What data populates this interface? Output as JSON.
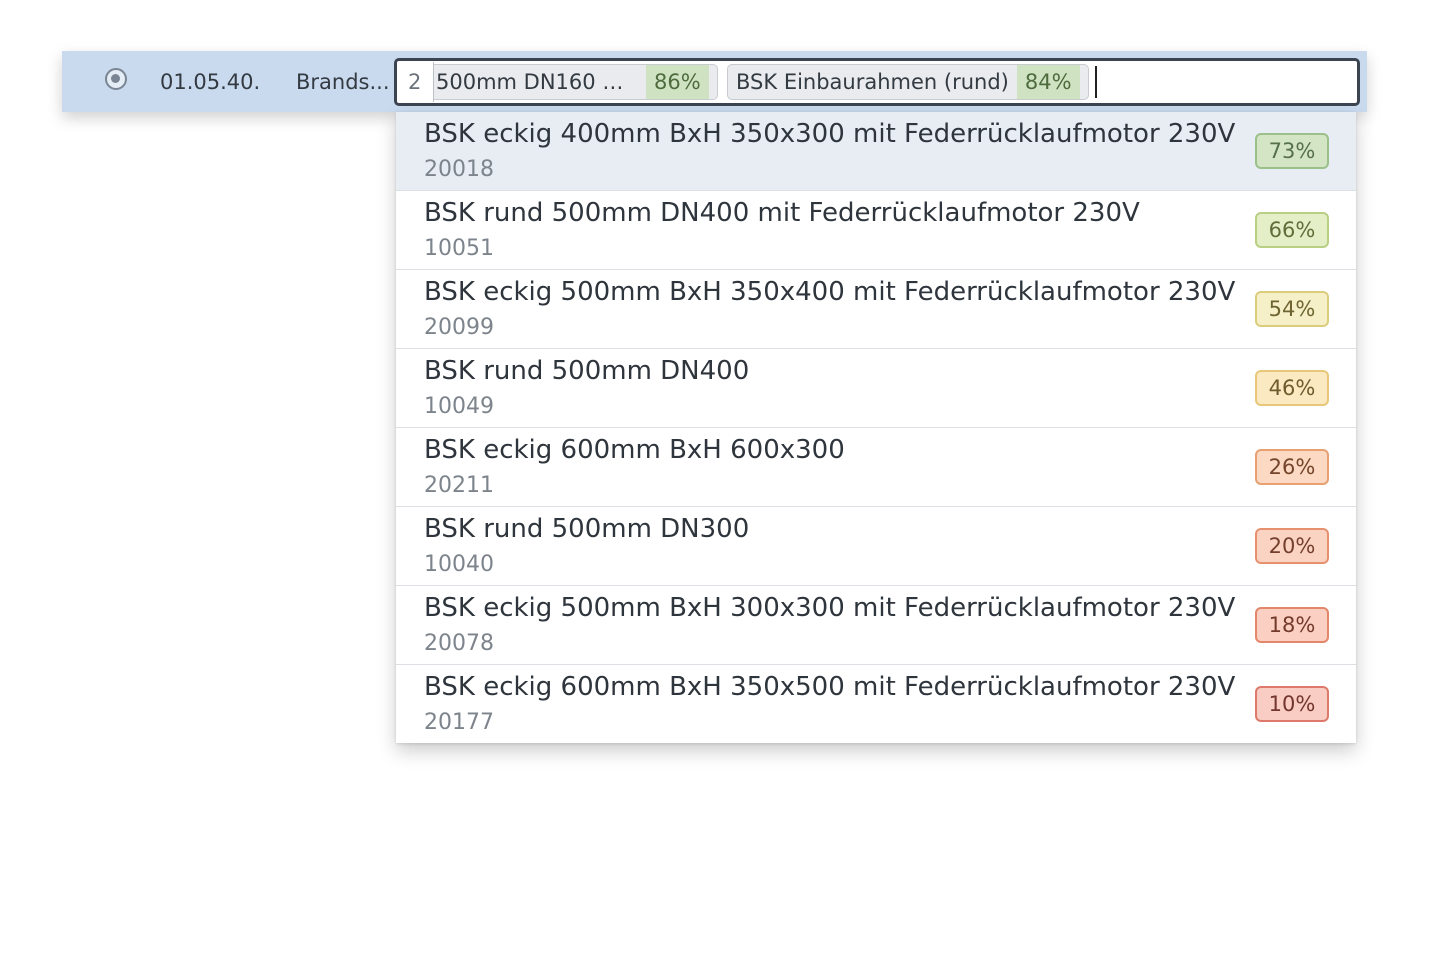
{
  "row": {
    "code": "01.05.40.",
    "name": "Brands..."
  },
  "input": {
    "count": "2",
    "chips": [
      {
        "label": "500mm DN160 m...",
        "pct": "86%"
      },
      {
        "label": "BSK Einbaurahmen (rund)",
        "pct": "84%"
      }
    ]
  },
  "dropdown": {
    "items": [
      {
        "title": "BSK eckig 400mm BxH 350x300 mit Federrücklaufmotor 230V",
        "id": "20018",
        "pct": "73%",
        "bg": "#d4e5c6",
        "border": "#9cc08a",
        "color": "#56714a"
      },
      {
        "title": "BSK rund 500mm DN400 mit Federrücklaufmotor 230V",
        "id": "10051",
        "pct": "66%",
        "bg": "#e4eec7",
        "border": "#b8cf84",
        "color": "#5f6e3a"
      },
      {
        "title": "BSK eckig 500mm BxH 350x400 mit Federrücklaufmotor 230V",
        "id": "20099",
        "pct": "54%",
        "bg": "#f6f0c8",
        "border": "#dccd7c",
        "color": "#6e6532"
      },
      {
        "title": "BSK rund 500mm DN400",
        "id": "10049",
        "pct": "46%",
        "bg": "#fbe9c2",
        "border": "#e8c878",
        "color": "#6f5a2c"
      },
      {
        "title": "BSK eckig 600mm BxH 600x300",
        "id": "20211",
        "pct": "26%",
        "bg": "#fbd9c2",
        "border": "#e8a072",
        "color": "#74452a"
      },
      {
        "title": "BSK rund 500mm DN300",
        "id": "10040",
        "pct": "20%",
        "bg": "#fbd3c2",
        "border": "#e6906e",
        "color": "#743f2c"
      },
      {
        "title": "BSK eckig 500mm BxH 300x300 mit Federrücklaufmotor 230V",
        "id": "20078",
        "pct": "18%",
        "bg": "#fbd0c2",
        "border": "#e4866a",
        "color": "#733a2c"
      },
      {
        "title": "BSK eckig 600mm BxH 350x500 mit Federrücklaufmotor 230V",
        "id": "20177",
        "pct": "10%",
        "bg": "#f9ccc4",
        "border": "#de7a6c",
        "color": "#72362e"
      }
    ]
  }
}
